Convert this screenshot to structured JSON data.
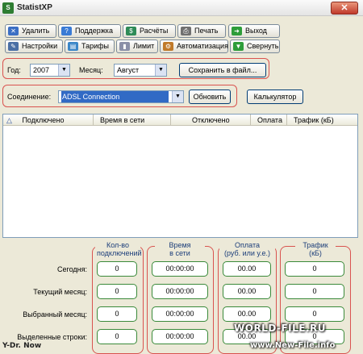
{
  "window": {
    "title": "StatistXP",
    "close_glyph": "✕"
  },
  "toolbar": {
    "row1": [
      {
        "label": "Удалить",
        "icon": "delete-icon",
        "color": "#3b6fc4",
        "glyph": "✕"
      },
      {
        "label": "Поддержка",
        "icon": "support-icon",
        "color": "#3a7bd5",
        "glyph": "?"
      },
      {
        "label": "Расчёты",
        "icon": "calculations-icon",
        "color": "#2e8b57",
        "glyph": "$"
      },
      {
        "label": "Печать",
        "icon": "printer-icon",
        "color": "#707070",
        "glyph": "⎙"
      },
      {
        "label": "Выход",
        "icon": "exit-icon",
        "color": "#2e9d3a",
        "glyph": "➜"
      }
    ],
    "row2": [
      {
        "label": "Настройки",
        "icon": "settings-icon",
        "color": "#4a6fa5",
        "glyph": "✎"
      },
      {
        "label": "Тарифы",
        "icon": "tariffs-icon",
        "color": "#3a86c8",
        "glyph": "▤"
      },
      {
        "label": "Лимит",
        "icon": "limit-icon",
        "color": "#8a8fa8",
        "glyph": "▮"
      },
      {
        "label": "Автоматизация",
        "icon": "automation-icon",
        "color": "#c07a2a",
        "glyph": "⚙"
      },
      {
        "label": "Свернуть",
        "icon": "minimize-icon",
        "color": "#2e9d3a",
        "glyph": "▼"
      }
    ]
  },
  "filters": {
    "year_label": "Год:",
    "year_value": "2007",
    "month_label": "Месяц:",
    "month_value": "Август",
    "save_button": "Сохранить в файл...",
    "connection_label": "Соединение:",
    "connection_value": "ADSL Connection",
    "refresh_button": "Обновить",
    "calculator_button": "Калькулятор",
    "combo_arrow": "▼"
  },
  "table": {
    "sort_glyph": "△",
    "columns": [
      "Подключено",
      "Время в сети",
      "Отключено",
      "Оплата",
      "Трафик (кБ)"
    ]
  },
  "stats": {
    "rows": [
      "Сегодня:",
      "Текущий месяц:",
      "Выбранный месяц:",
      "Выделенные строки:"
    ],
    "col_connections": {
      "title1": "Кол-во",
      "title2": "подключений",
      "values": [
        "0",
        "0",
        "0",
        "0"
      ]
    },
    "col_time": {
      "title1": "Время",
      "title2": "в сети",
      "values": [
        "00:00:00",
        "00:00:00",
        "00:00:00",
        "00:00:00"
      ]
    },
    "col_payment": {
      "title1": "Оплата",
      "title2": "(руб. или у.е.)",
      "values": [
        "00.00",
        "00.00",
        "00.00",
        "00.00"
      ]
    },
    "col_traffic": {
      "title1": "Трафик",
      "title2": "(кБ)",
      "values": [
        "0",
        "0",
        "0",
        "0"
      ]
    }
  },
  "watermarks": {
    "author": "Y-Dr. Now",
    "site1": "WORLD-FILE",
    "site1_suffix": ".RU",
    "site2": "www.New-File.info"
  }
}
